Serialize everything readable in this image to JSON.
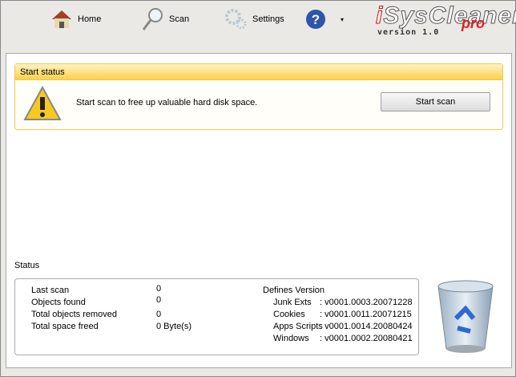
{
  "toolbar": {
    "items": [
      {
        "label": "Home",
        "icon": "house-icon"
      },
      {
        "label": "Scan",
        "icon": "magnifier-icon"
      },
      {
        "label": "Settings",
        "icon": "gears-icon"
      }
    ],
    "help_icon": "help-icon"
  },
  "logo": {
    "name": "iSysCleaner",
    "edition": "pro",
    "version": "version 1.0"
  },
  "start_status": {
    "title": "Start status",
    "message": "Start scan to free up valuable hard disk space.",
    "button": "Start scan"
  },
  "status": {
    "title": "Status",
    "stats": [
      {
        "label": "Last scan",
        "value": "0"
      },
      {
        "label": "Objects found",
        "value": "0"
      },
      {
        "label": "Total objects removed",
        "value": "0"
      },
      {
        "label": "Total space freed",
        "value": "0 Byte(s)"
      }
    ],
    "defines_title": "Defines Version",
    "defines": [
      {
        "label": "Junk Exts",
        "value": ": v0001.0003.20071228"
      },
      {
        "label": "Cookies",
        "value": ": v0001.0011.20071215"
      },
      {
        "label": "Apps Scripts",
        "value": ": v0001.0014.20080424"
      },
      {
        "label": "Windows",
        "value": ": v0001.0002.20080421"
      }
    ]
  },
  "colors": {
    "accent": "#fbd04a",
    "border": "#f0c850"
  }
}
